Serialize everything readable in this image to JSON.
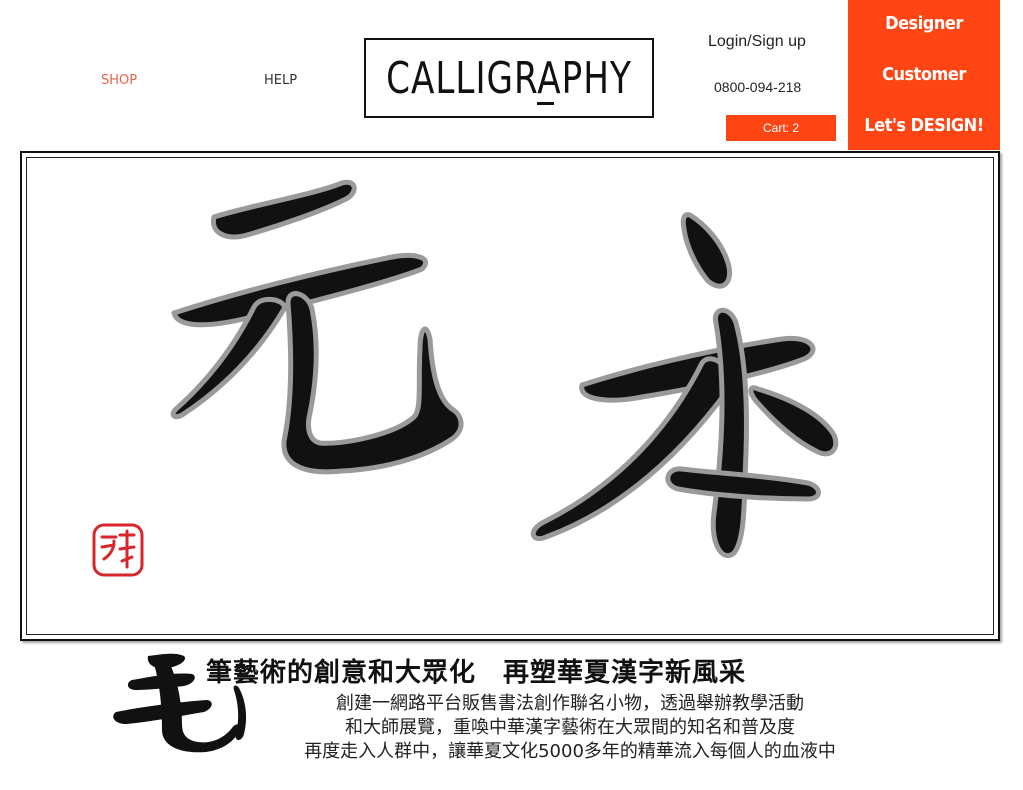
{
  "colors": {
    "accent": "#ff4514",
    "side_panel": "#ff4514",
    "shop_link": "#e8654a",
    "text": "#222222",
    "seal_red": "#d9262a"
  },
  "nav": {
    "shop_label": "SHOP",
    "help_label": "HELP"
  },
  "logo": {
    "text": "CALLIGRAPHY"
  },
  "account": {
    "login_label": "Login/Sign up",
    "phone": "0800-094-218",
    "cart_label": "Cart: 2"
  },
  "side_menu": {
    "designer_label": "Designer",
    "customer_label": "Customer",
    "design_label": "Let's DESIGN!"
  },
  "banner": {
    "characters": "元本",
    "seal_icon": "red-seal-stamp-icon"
  },
  "intro": {
    "brush_character": "毛",
    "headline": "筆藝術的創意和大眾化　再塑華夏漢字新風采",
    "lines": [
      "創建一網路平台販售書法創作聯名小物，透過舉辦教學活動",
      "和大師展覽，重喚中華漢字藝術在大眾間的知名和普及度",
      "再度走入人群中，讓華夏文化5000多年的精華流入每個人的血液中"
    ]
  }
}
